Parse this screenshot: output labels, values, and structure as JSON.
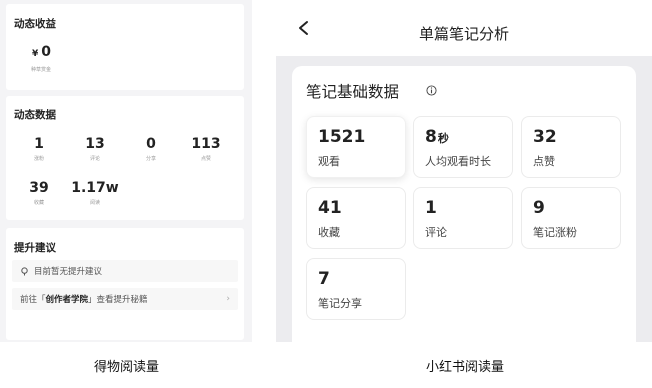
{
  "left_panel": {
    "income": {
      "title": "动态收益",
      "currency": "¥",
      "amount": "0",
      "sub": "种草赏金"
    },
    "dynamic": {
      "title": "动态数据",
      "stats": [
        {
          "value": "1",
          "label": "涨粉"
        },
        {
          "value": "13",
          "label": "评论"
        },
        {
          "value": "0",
          "label": "分享"
        },
        {
          "value": "113",
          "label": "点赞"
        },
        {
          "value": "39",
          "label": "收藏"
        },
        {
          "value": "1.17w",
          "label": "阅读"
        }
      ]
    },
    "suggestions": {
      "title": "提升建议",
      "tip": "目前暂无提升建议",
      "link_prefix": "前往「",
      "link_strong": "创作者学院",
      "link_suffix": "」查看提升秘籍",
      "arrow": "›"
    }
  },
  "right_panel": {
    "header_title": "单篇笔记分析",
    "section_title": "笔记基础数据",
    "tiles": [
      {
        "value": "1521",
        "unit": "",
        "label": "观看"
      },
      {
        "value": "8",
        "unit": "秒",
        "label": "人均观看时长"
      },
      {
        "value": "32",
        "unit": "",
        "label": "点赞"
      },
      {
        "value": "41",
        "unit": "",
        "label": "收藏"
      },
      {
        "value": "1",
        "unit": "",
        "label": "评论"
      },
      {
        "value": "9",
        "unit": "",
        "label": "笔记涨粉"
      },
      {
        "value": "7",
        "unit": "",
        "label": "笔记分享"
      }
    ]
  },
  "captions": {
    "left": "得物阅读量",
    "right": "小红书阅读量"
  }
}
